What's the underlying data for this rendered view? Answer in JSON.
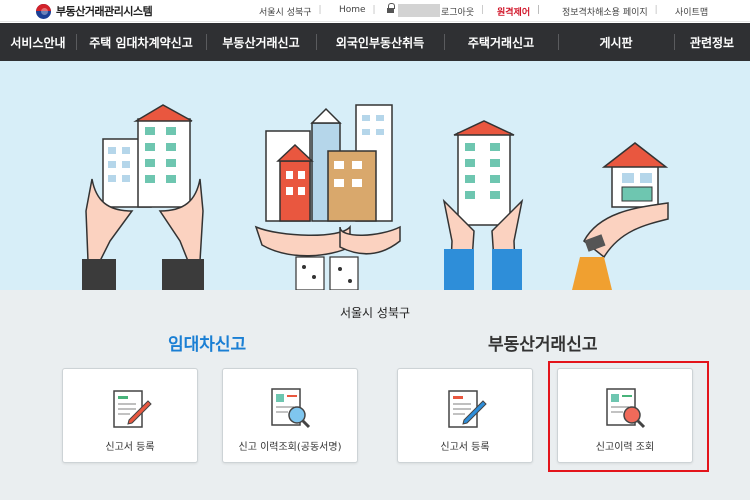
{
  "header": {
    "site_title": "부동산거래관리시스템",
    "region": "서울시 성북구",
    "home": "Home",
    "logout": "로그아웃",
    "remote_control": "원격제어",
    "privacy": "정보격차해소용 페이지",
    "sitemap": "사이트맵"
  },
  "nav": {
    "items": [
      "서비스안내",
      "주택 임대차계약신고",
      "부동산거래신고",
      "외국인부동산취득",
      "주택거래신고",
      "게시판",
      "관련정보"
    ]
  },
  "main": {
    "region_label": "서울시 성북구",
    "sections": [
      {
        "title": "임대차신고",
        "cards": [
          "신고서 등록",
          "신고 이력조회(공동서명)"
        ]
      },
      {
        "title": "부동산거래신고",
        "cards": [
          "신고서 등록",
          "신고이력 조회"
        ]
      }
    ]
  },
  "colors": {
    "nav_bg": "#2f3033",
    "hero_bg": "#d7eef8",
    "accent_blue": "#1a7fd4",
    "remote_red": "#d1162a",
    "highlight": "#e3141b"
  }
}
